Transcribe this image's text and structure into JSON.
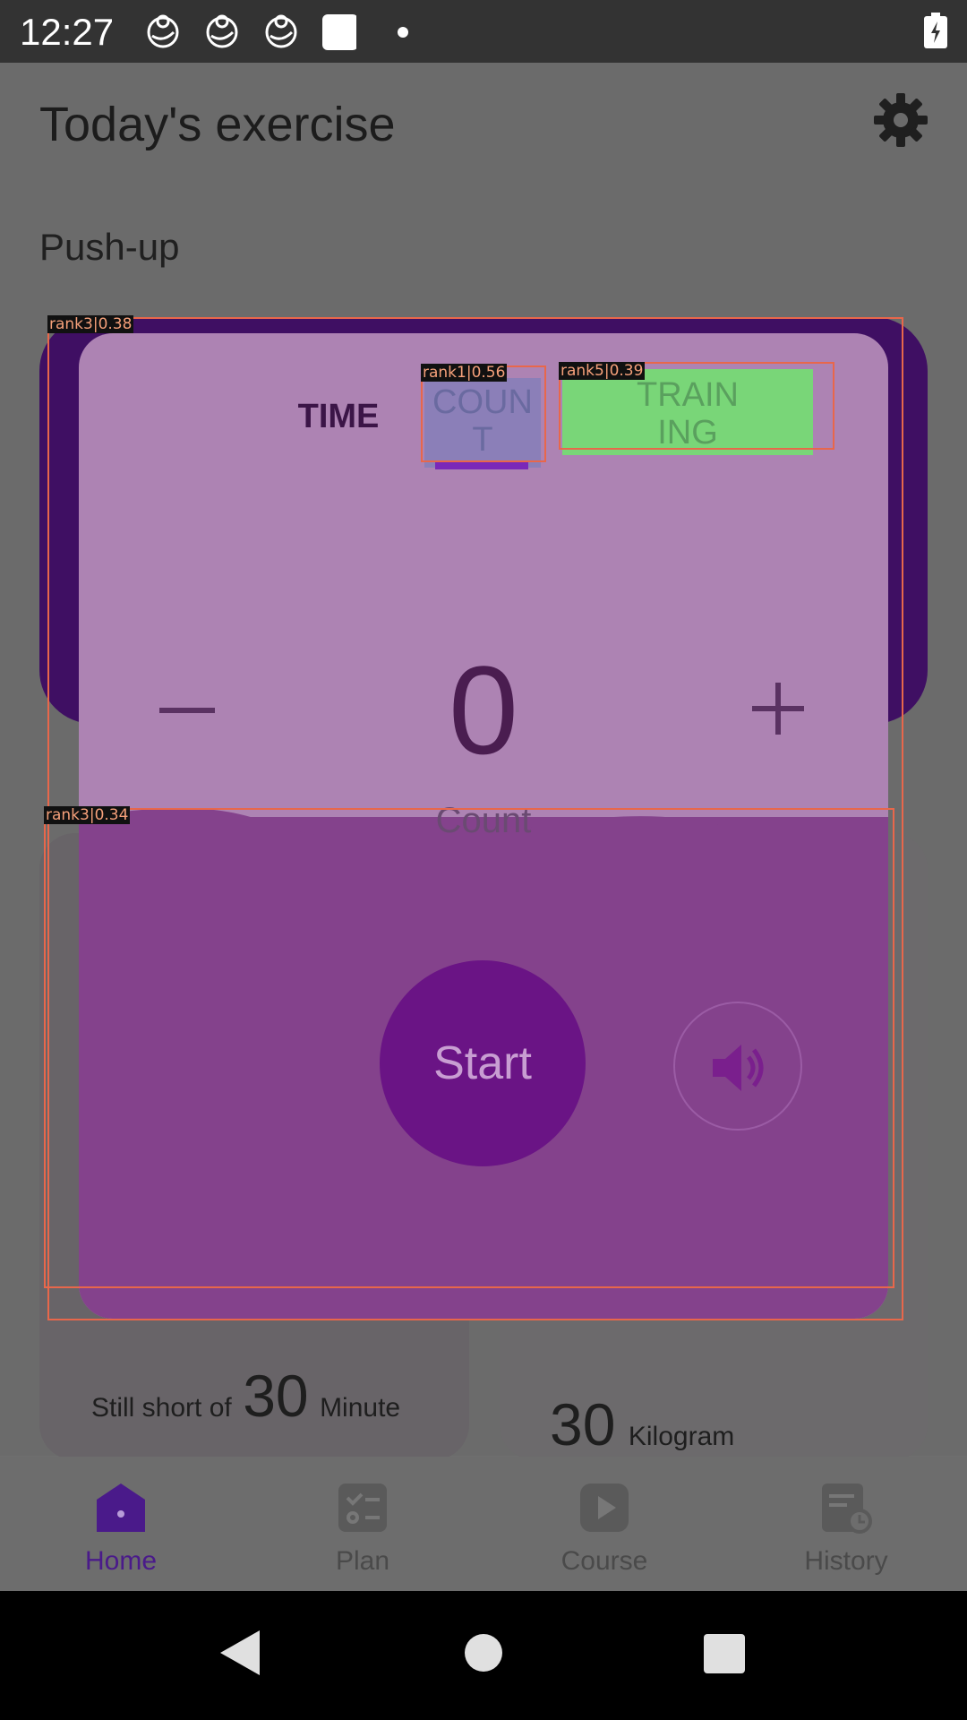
{
  "status_bar": {
    "time": "12:27",
    "icons": [
      "sync-icon",
      "sync-icon",
      "sync-icon",
      "square-icon",
      "dot-icon",
      "battery-charging-icon"
    ]
  },
  "header": {
    "title": "Today's exercise",
    "settings_icon": "gear-icon"
  },
  "exercise": {
    "name": "Push-up"
  },
  "dialog": {
    "tabs": [
      {
        "label": "TIME"
      },
      {
        "label": "COUN\nT"
      },
      {
        "label": "TRAIN\nING"
      }
    ],
    "counter": {
      "value": "0",
      "label": "Count"
    },
    "start_label": "Start",
    "sound_icon": "speaker-icon"
  },
  "cards": {
    "time_card": {
      "prefix": "Still short of",
      "value": "30",
      "unit": "Minute"
    },
    "weight_card": {
      "value": "30",
      "unit": "Kilogram"
    }
  },
  "bottom_nav": {
    "items": [
      {
        "label": "Home",
        "icon": "home-icon"
      },
      {
        "label": "Plan",
        "icon": "checklist-icon"
      },
      {
        "label": "Course",
        "icon": "play-icon"
      },
      {
        "label": "History",
        "icon": "history-icon"
      }
    ]
  },
  "overlay": {
    "tags": [
      "rank3|0.38",
      "rank1|0.56",
      "rank5|0.39",
      "rank3|0.34"
    ]
  },
  "colors": {
    "accent": "#6a1485",
    "dialog_bg": "#ad83b3",
    "highlight_green": "#79d678",
    "highlight_blue": "#8b7fb8",
    "overlay_box": "#e8674b"
  }
}
